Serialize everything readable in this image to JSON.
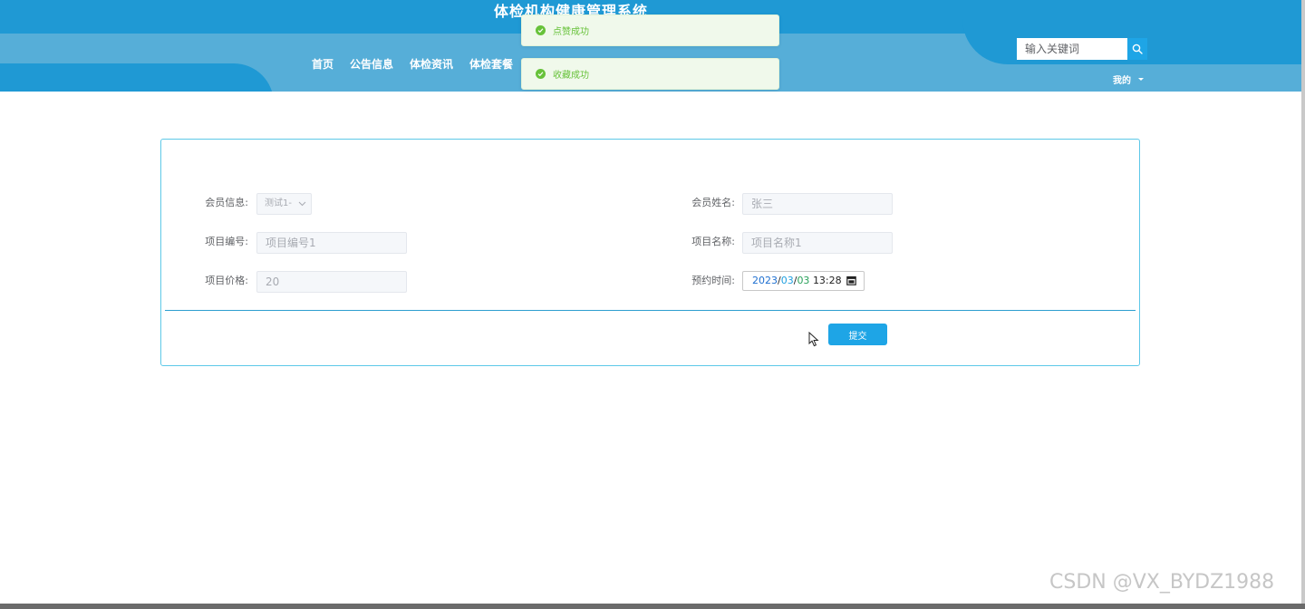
{
  "header": {
    "title": "体检机构健康管理系统",
    "nav": [
      "首页",
      "公告信息",
      "体检资讯",
      "体检套餐"
    ],
    "search_placeholder": "输入关键词",
    "user_menu": "我的"
  },
  "toasts": [
    "点赞成功",
    "收藏成功"
  ],
  "form": {
    "member_info_label": "会员信息:",
    "member_info_value": "测试1-",
    "member_name_label": "会员姓名:",
    "member_name_value": "张三",
    "item_code_label": "项目编号:",
    "item_code_value": "项目编号1",
    "item_name_label": "项目名称:",
    "item_name_value": "项目名称1",
    "item_price_label": "项目价格:",
    "item_price_value": "20",
    "appointment_time_label": "预约时间:",
    "appointment_year": "2023",
    "appointment_month": "03",
    "appointment_day": "03",
    "appointment_time": "13:28",
    "submit_label": "提交"
  },
  "watermark": "CSDN @VX_BYDZ1988",
  "colors": {
    "header_dark": "#1f99d4",
    "header_light": "#56aed8",
    "primary": "#1ea5e6",
    "success": "#67c23a",
    "card_border": "#5dc8e8"
  }
}
